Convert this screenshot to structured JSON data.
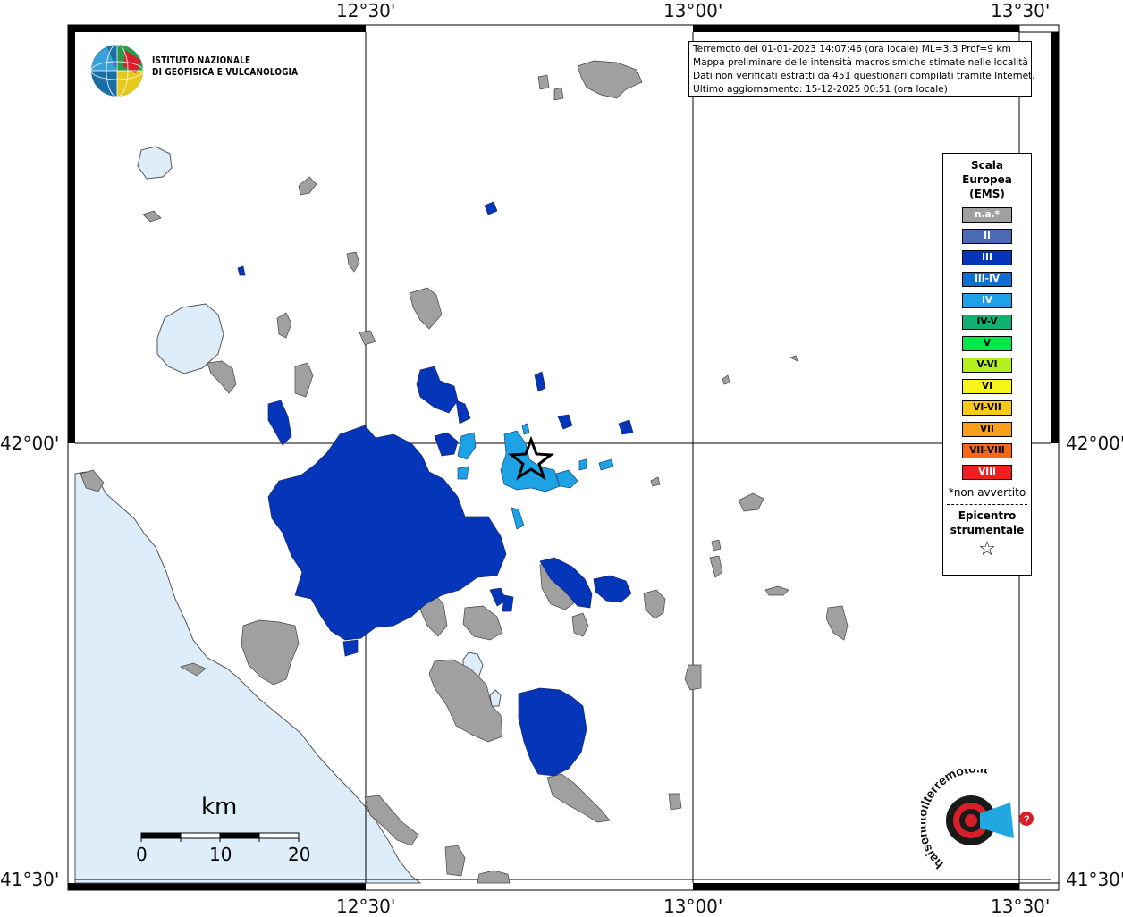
{
  "map": {
    "top_axis_labels": [
      "12°30'",
      "13°00'",
      "13°30'"
    ],
    "bottom_axis_labels": [
      "12°30'",
      "13°00'",
      "13°30'"
    ],
    "left_axis_labels": [
      "42°00'",
      "41°30'"
    ],
    "right_axis_labels": [
      "42°00'",
      "41°30'"
    ],
    "sea_color": "#ddeefa",
    "lake_color": "#ddeefa",
    "locality_na_color": "#a0a0a0",
    "grid_color": "#000000"
  },
  "info": {
    "line1": "Terremoto del 01-01-2023 14:07:46 (ora locale) ML=3.3 Prof=9 km",
    "line2": "Mappa preliminare delle intensità macrosismiche stimate nelle località",
    "line3": "Dati non verificati estratti da 451 questionari compilati tramite Internet.",
    "line4": "Ultimo aggiornamento: 15-12-2025 00:51 (ora locale)"
  },
  "logo": {
    "line1": "ISTITUTO NAZIONALE",
    "line2": "DI GEOFISICA E VULCANOLOGIA",
    "icon": "globe-icon"
  },
  "legend": {
    "title_l1": "Scala",
    "title_l2": "Europea",
    "title_l3": "(EMS)",
    "items": [
      {
        "label": "n.a.*",
        "color": "#a0a0a0",
        "text_color": "#ffffff"
      },
      {
        "label": "II",
        "color": "#4a6bb4",
        "text_color": "#ffffff"
      },
      {
        "label": "III",
        "color": "#0535b8",
        "text_color": "#ffffff"
      },
      {
        "label": "III-IV",
        "color": "#0d6fd2",
        "text_color": "#ffffff"
      },
      {
        "label": "IV",
        "color": "#1ea2e6",
        "text_color": "#ffffff"
      },
      {
        "label": "IV-V",
        "color": "#10b070",
        "text_color": "#000000"
      },
      {
        "label": "V",
        "color": "#00e84a",
        "text_color": "#000000"
      },
      {
        "label": "V-VI",
        "color": "#b4f01e",
        "text_color": "#000000"
      },
      {
        "label": "VI",
        "color": "#f8f41a",
        "text_color": "#000000"
      },
      {
        "label": "VI-VII",
        "color": "#f8c81a",
        "text_color": "#000000"
      },
      {
        "label": "VII",
        "color": "#f8a01a",
        "text_color": "#000000"
      },
      {
        "label": "VII-VIII",
        "color": "#f86814",
        "text_color": "#000000"
      },
      {
        "label": "VIII",
        "color": "#f01e1e",
        "text_color": "#ffffff"
      }
    ],
    "note": "*non avvertito",
    "epicenter_l1": "Epicentro",
    "epicenter_l2": "strumentale",
    "epicenter_icon": "star-outline-icon"
  },
  "scalebar": {
    "title": "km",
    "labels": [
      "0",
      "10",
      "20"
    ]
  },
  "brand": {
    "text": "haisentitoilterremoto.it",
    "icon": "seismograph-logo-icon"
  }
}
